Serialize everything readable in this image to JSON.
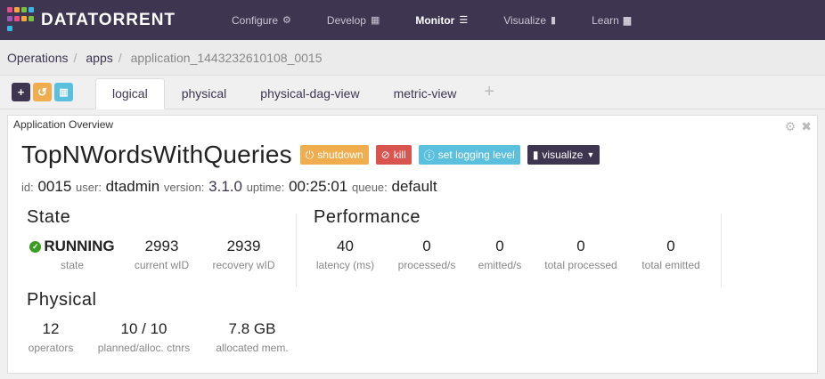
{
  "brand": {
    "name": "DataTorrent"
  },
  "nav": {
    "items": [
      {
        "label": "Configure",
        "icon": "gear-icon",
        "glyph": "⚙"
      },
      {
        "label": "Develop",
        "icon": "grid-icon",
        "glyph": "▦"
      },
      {
        "label": "Monitor",
        "icon": "list-icon",
        "glyph": "☰"
      },
      {
        "label": "Visualize",
        "icon": "bar-chart-icon",
        "glyph": "▮"
      },
      {
        "label": "Learn",
        "icon": "book-icon",
        "glyph": "▆"
      }
    ]
  },
  "breadcrumb": {
    "items": [
      "Operations",
      "apps"
    ],
    "current": "application_1443232610108_0015"
  },
  "toolbar": {
    "add": "+",
    "reset": "↺",
    "delete": "🗑"
  },
  "tabs": [
    "logical",
    "physical",
    "physical-dag-view",
    "metric-view"
  ],
  "panel": {
    "title": "Application Overview"
  },
  "app": {
    "name": "TopNWordsWithQueries",
    "buttons": {
      "shutdown": "shutdown",
      "kill": "kill",
      "log": "set logging level",
      "visualize": "visualize"
    },
    "meta": {
      "id_label": "id:",
      "id": "0015",
      "user_label": "user:",
      "user": "dtadmin",
      "version_label": "version:",
      "version": "3.1.0",
      "uptime_label": "uptime:",
      "uptime": "00:25:01",
      "queue_label": "queue:",
      "queue": "default"
    }
  },
  "state": {
    "title": "State",
    "status": "RUNNING",
    "status_label": "state",
    "current_wid": "2993",
    "current_wid_label": "current wID",
    "recovery_wid": "2939",
    "recovery_wid_label": "recovery wID"
  },
  "performance": {
    "title": "Performance",
    "latency": "40",
    "latency_label": "latency (ms)",
    "processed": "0",
    "processed_label": "processed/s",
    "emitted": "0",
    "emitted_label": "emitted/s",
    "total_processed": "0",
    "total_processed_label": "total processed",
    "total_emitted": "0",
    "total_emitted_label": "total emitted"
  },
  "physical": {
    "title": "Physical",
    "operators": "12",
    "operators_label": "operators",
    "containers": "10 / 10",
    "containers_label": "planned/alloc. ctnrs",
    "memory": "7.8 GB",
    "memory_label": "allocated mem."
  },
  "colors": {
    "nav_bg": "#3e3550",
    "running": "#3a9d23",
    "shutdown": "#f0ad4e",
    "kill": "#d9534f",
    "log": "#5bc0de"
  }
}
